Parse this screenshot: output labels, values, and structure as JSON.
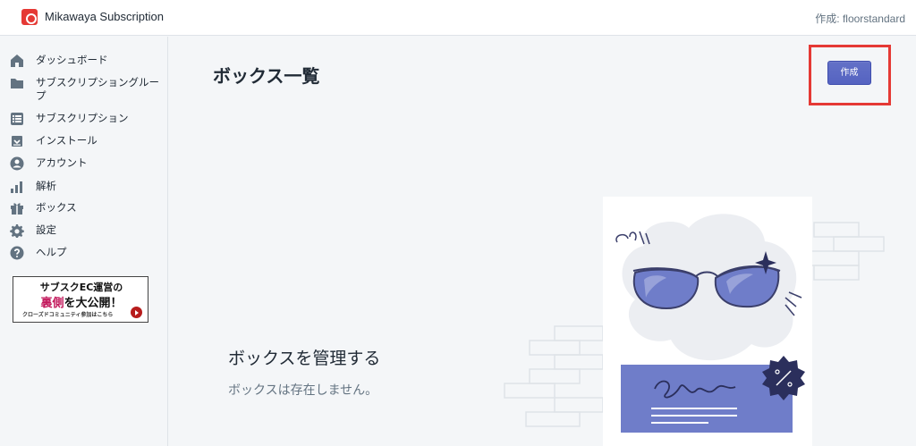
{
  "app": {
    "title": "Mikawaya Subscription",
    "user_label": "作成: floorstandard"
  },
  "sidebar": {
    "items": [
      {
        "label": "ダッシュボード",
        "icon": "home-icon"
      },
      {
        "label": "サブスクリプショングループ",
        "icon": "folder-icon"
      },
      {
        "label": "サブスクリプション",
        "icon": "list-icon"
      },
      {
        "label": "インストール",
        "icon": "install-icon"
      },
      {
        "label": "アカウント",
        "icon": "account-icon"
      },
      {
        "label": "解析",
        "icon": "bar-chart-icon"
      },
      {
        "label": "ボックス",
        "icon": "gift-icon"
      },
      {
        "label": "設定",
        "icon": "gear-icon"
      },
      {
        "label": "ヘルプ",
        "icon": "help-icon"
      }
    ]
  },
  "banner": {
    "line1": "サブスクEC運営の",
    "line2_accent": "裏側",
    "line2_rest": "を大公開！",
    "line3": "クローズドコミュニティ参加はこちら"
  },
  "main": {
    "title": "ボックス一覧",
    "create_label": "作成",
    "empty_heading": "ボックスを管理する",
    "empty_sub": "ボックスは存在しません。"
  },
  "colors": {
    "primary": "#5c6ac4",
    "highlight": "#e53935",
    "icon": "#637381"
  }
}
